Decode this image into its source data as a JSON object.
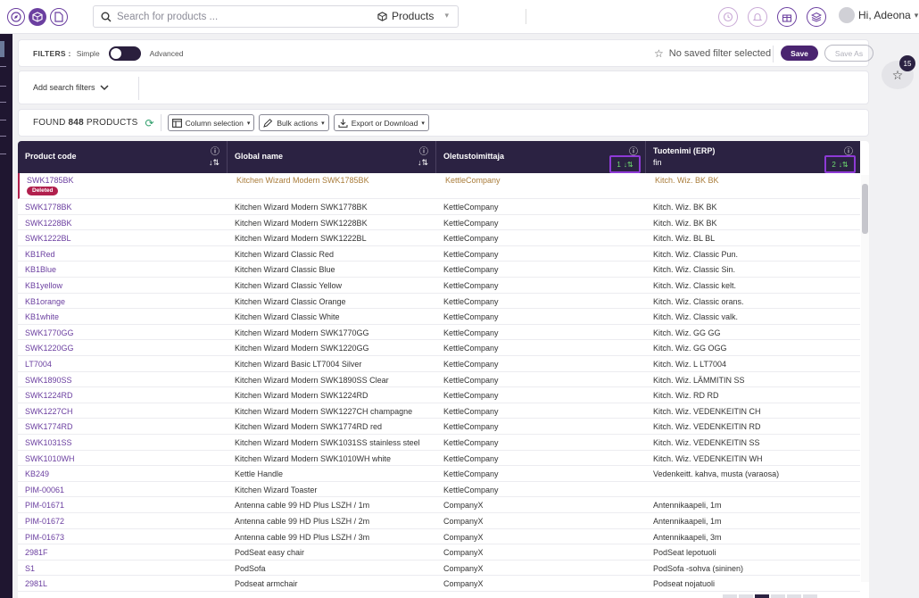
{
  "search": {
    "placeholder": "Search for products ...",
    "scope": "Products"
  },
  "user": {
    "greeting": "Hi, Adeona"
  },
  "filters": {
    "label": "FILTERS :",
    "simple": "Simple",
    "advanced": "Advanced",
    "saved": "No saved filter selected",
    "save": "Save",
    "save_as": "Save As",
    "add": "Add search filters"
  },
  "toolbar": {
    "found_prefix": "FOUND",
    "found_count": "848",
    "found_suffix": "PRODUCTS",
    "column_selection": "Column selection",
    "bulk_actions": "Bulk actions",
    "export": "Export or Download"
  },
  "columns": [
    {
      "title": "Product code",
      "sub": ""
    },
    {
      "title": "Global name",
      "sub": ""
    },
    {
      "title": "Oletustoimittaja",
      "sub": "",
      "sort_order": "1"
    },
    {
      "title": "Tuotenimi (ERP)",
      "sub": "fin",
      "sort_order": "2"
    }
  ],
  "deleted_label": "Deleted",
  "notifications_count": "15",
  "rows": [
    [
      "SWK1785BK",
      "Kitchen Wizard Modern SWK1785BK",
      "KettleCompany",
      "Kitch. Wiz. BK BK"
    ],
    [
      "SWK1778BK",
      "Kitchen Wizard Modern SWK1778BK",
      "KettleCompany",
      "Kitch. Wiz. BK BK"
    ],
    [
      "SWK1228BK",
      "Kitchen Wizard Modern SWK1228BK",
      "KettleCompany",
      "Kitch. Wiz. BK BK"
    ],
    [
      "SWK1222BL",
      "Kitchen Wizard Modern SWK1222BL",
      "KettleCompany",
      "Kitch. Wiz. BL BL"
    ],
    [
      "KB1Red",
      "Kitchen Wizard Classic Red",
      "KettleCompany",
      "Kitch. Wiz. Classic Pun."
    ],
    [
      "KB1Blue",
      "Kitchen Wizard Classic Blue",
      "KettleCompany",
      "Kitch. Wiz. Classic Sin."
    ],
    [
      "KB1yellow",
      "Kitchen Wizard Classic Yellow",
      "KettleCompany",
      "Kitch. Wiz. Classic kelt."
    ],
    [
      "KB1orange",
      "Kitchen Wizard Classic Orange",
      "KettleCompany",
      "Kitch. Wiz. Classic orans."
    ],
    [
      "KB1white",
      "Kitchen Wizard Classic White",
      "KettleCompany",
      "Kitch. Wiz. Classic valk."
    ],
    [
      "SWK1770GG",
      "Kitchen Wizard Modern SWK1770GG",
      "KettleCompany",
      "Kitch. Wiz. GG GG"
    ],
    [
      "SWK1220GG",
      "Kitchen Wizard Modern SWK1220GG",
      "KettleCompany",
      "Kitch. Wiz. GG OGG"
    ],
    [
      "LT7004",
      "Kitchen Wizard Basic LT7004 Silver",
      "KettleCompany",
      "Kitch. Wiz. L LT7004"
    ],
    [
      "SWK1890SS",
      "Kitchen Wizard Modern SWK1890SS Clear",
      "KettleCompany",
      "Kitch. Wiz. LÄMMITIN SS"
    ],
    [
      "SWK1224RD",
      "Kitchen Wizard Modern SWK1224RD",
      "KettleCompany",
      "Kitch. Wiz. RD RD"
    ],
    [
      "SWK1227CH",
      "Kitchen Wizard Modern SWK1227CH champagne",
      "KettleCompany",
      "Kitch. Wiz. VEDENKEITIN CH"
    ],
    [
      "SWK1774RD",
      "Kitchen Wizard Modern SWK1774RD red",
      "KettleCompany",
      "Kitch. Wiz. VEDENKEITIN RD"
    ],
    [
      "SWK1031SS",
      "Kitchen Wizard Modern SWK1031SS stainless steel",
      "KettleCompany",
      "Kitch. Wiz. VEDENKEITIN SS"
    ],
    [
      "SWK1010WH",
      "Kitchen Wizard Modern SWK1010WH white",
      "KettleCompany",
      "Kitch. Wiz. VEDENKEITIN WH"
    ],
    [
      "KB249",
      "Kettle Handle",
      "KettleCompany",
      "Vedenkeitt. kahva, musta (varaosa)"
    ],
    [
      "PIM-00061",
      "Kitchen Wizard Toaster",
      "KettleCompany",
      ""
    ],
    [
      "PIM-01671",
      "Antenna cable 99 HD Plus LSZH / 1m",
      "CompanyX",
      "Antennikaapeli, 1m"
    ],
    [
      "PIM-01672",
      "Antenna cable 99 HD Plus LSZH / 2m",
      "CompanyX",
      "Antennikaapeli, 1m"
    ],
    [
      "PIM-01673",
      "Antenna cable 99 HD Plus LSZH / 3m",
      "CompanyX",
      "Antennikaapeli, 3m"
    ],
    [
      "2981F",
      "PodSeat easy chair",
      "CompanyX",
      "PodSeat lepotuoli"
    ],
    [
      "S1",
      "PodSofa",
      "CompanyX",
      "PodSofa -sohva (sininen)"
    ],
    [
      "2981L",
      "Podseat armchair",
      "CompanyX",
      "Podseat nojatuoli"
    ]
  ],
  "colors": {
    "brand": "#6b3fa0",
    "header": "#2b2242",
    "deleted": "#b11f4d",
    "sort_highlight": "#8e3ad6"
  }
}
